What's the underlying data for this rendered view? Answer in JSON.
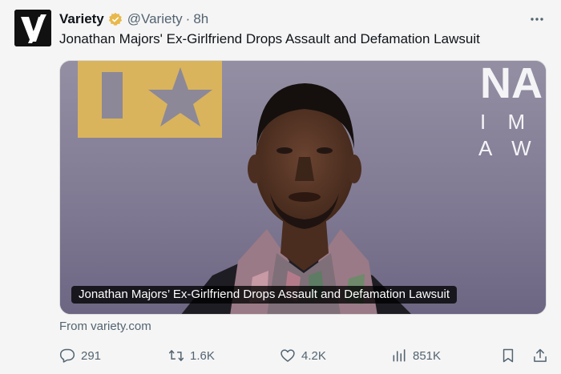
{
  "author": {
    "display_name": "Variety",
    "handle": "@Variety",
    "separator": "·",
    "time": "8h",
    "avatar_letter": "V"
  },
  "tweet": {
    "text": "Jonathan Majors' Ex-Girlfriend Drops Assault and Defamation Lawsuit"
  },
  "card": {
    "overlay_title": "Jonathan Majors’ Ex-Girlfriend Drops Assault and Defamation Lawsuit",
    "backdrop_text": [
      "NA",
      "I M",
      "A W A"
    ],
    "source": "From variety.com"
  },
  "actions": {
    "replies": "291",
    "reposts": "1.6K",
    "likes": "4.2K",
    "views": "851K"
  },
  "icons": {
    "verified": "verified-badge-icon",
    "more": "more-dots-icon",
    "reply": "reply-icon",
    "repost": "repost-icon",
    "like": "heart-icon",
    "views": "views-icon",
    "bookmark": "bookmark-icon",
    "share": "share-icon"
  },
  "colors": {
    "text": "#0f1419",
    "secondary": "#536471",
    "verified_gold": "#e8b84a",
    "background": "#f5f5f5"
  }
}
